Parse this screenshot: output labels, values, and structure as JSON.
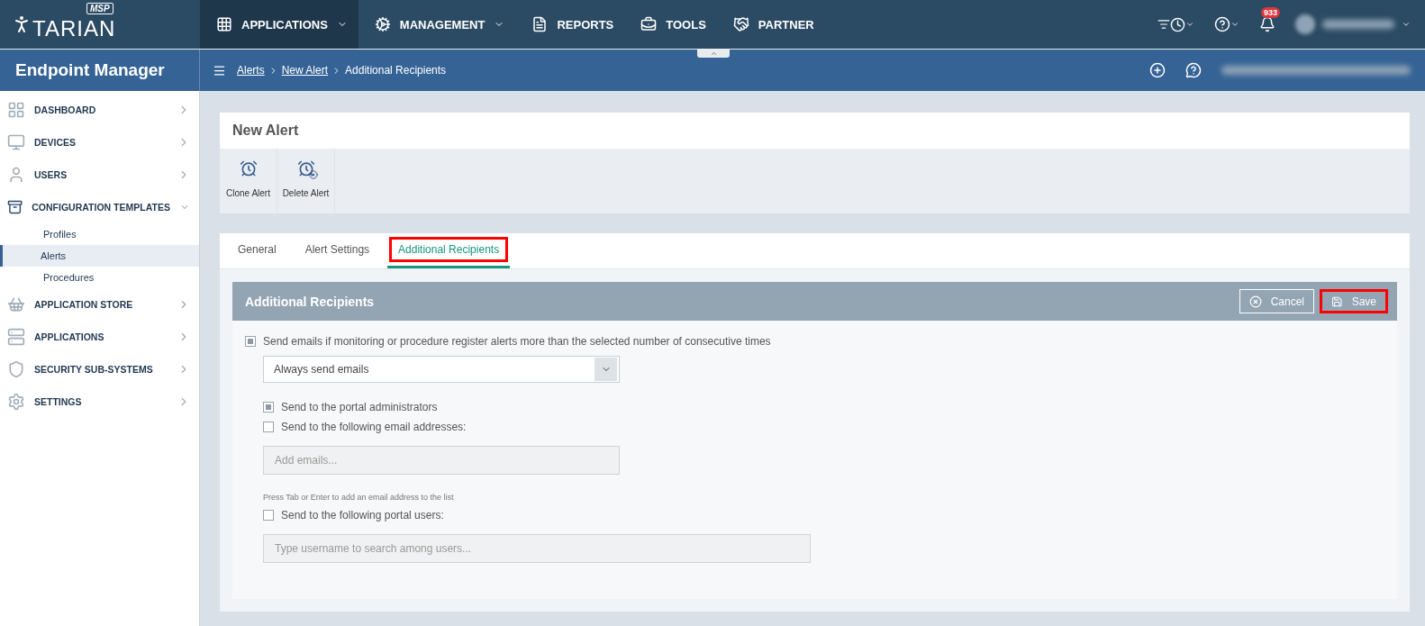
{
  "logo": {
    "text": "TARIAN",
    "badge": "MSP"
  },
  "top_nav": [
    {
      "label": "APPLICATIONS",
      "dropdown": true,
      "selected": true
    },
    {
      "label": "MANAGEMENT",
      "dropdown": true,
      "selected": false
    },
    {
      "label": "REPORTS",
      "dropdown": false,
      "selected": false
    },
    {
      "label": "TOOLS",
      "dropdown": false,
      "selected": false
    },
    {
      "label": "PARTNER",
      "dropdown": false,
      "selected": false
    }
  ],
  "notifications": {
    "count": "933"
  },
  "app_title": "Endpoint Manager",
  "breadcrumb": [
    {
      "label": "Alerts",
      "link": true
    },
    {
      "label": "New Alert",
      "link": true
    },
    {
      "label": "Additional Recipients",
      "link": false
    }
  ],
  "sidebar": {
    "items": [
      {
        "label": "DASHBOARD",
        "expanded": false
      },
      {
        "label": "DEVICES",
        "expanded": false
      },
      {
        "label": "USERS",
        "expanded": false
      },
      {
        "label": "CONFIGURATION TEMPLATES",
        "expanded": true,
        "children": [
          {
            "label": "Profiles",
            "selected": false
          },
          {
            "label": "Alerts",
            "selected": true
          },
          {
            "label": "Procedures",
            "selected": false
          }
        ]
      },
      {
        "label": "APPLICATION STORE",
        "expanded": false
      },
      {
        "label": "APPLICATIONS",
        "expanded": false
      },
      {
        "label": "SECURITY SUB-SYSTEMS",
        "expanded": false
      },
      {
        "label": "SETTINGS",
        "expanded": false
      }
    ]
  },
  "page_title": "New Alert",
  "toolbar": [
    {
      "label": "Clone Alert",
      "kind": "clone"
    },
    {
      "label": "Delete Alert",
      "kind": "delete"
    }
  ],
  "tabs": [
    {
      "label": "General",
      "selected": false,
      "highlighted": false
    },
    {
      "label": "Alert Settings",
      "selected": false,
      "highlighted": false
    },
    {
      "label": "Additional Recipients",
      "selected": true,
      "highlighted": true
    }
  ],
  "panel": {
    "title": "Additional Recipients",
    "buttons": [
      {
        "label": "Cancel",
        "kind": "cancel",
        "highlighted": false
      },
      {
        "label": "Save",
        "kind": "save",
        "highlighted": true
      }
    ],
    "rows": [
      {
        "kind": "checkbox",
        "label": "Send emails if monitoring or procedure register alerts more than the selected number of consecutive times",
        "checked": true
      },
      {
        "kind": "select",
        "value": "Always send emails"
      },
      {
        "kind": "checkbox",
        "label": "Send to the portal administrators",
        "checked": true
      },
      {
        "kind": "checkbox",
        "label": "Send to the following email addresses:",
        "checked": false
      },
      {
        "kind": "input",
        "placeholder": "Add emails..."
      },
      {
        "kind": "hint",
        "label": "Press Tab or Enter to add an email address to the list"
      },
      {
        "kind": "checkbox",
        "label": "Send to the following portal users:",
        "checked": false
      },
      {
        "kind": "input",
        "placeholder": "Type username to search among users..."
      }
    ]
  }
}
